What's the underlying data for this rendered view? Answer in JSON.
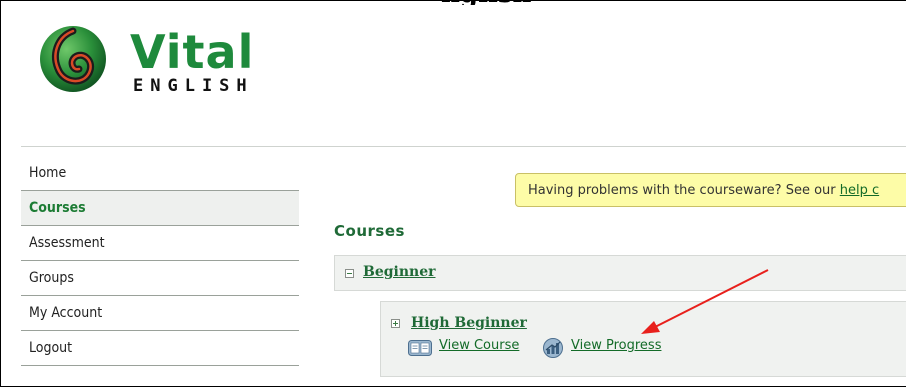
{
  "header": {
    "cut_heading": "nglish",
    "logo": {
      "brand": "Vital",
      "sub": "ENGLISH",
      "brand_color": "#1e8a3c"
    }
  },
  "sidebar": {
    "items": [
      {
        "label": "Home",
        "active": false
      },
      {
        "label": "Courses",
        "active": true
      },
      {
        "label": "Assessment",
        "active": false
      },
      {
        "label": "Groups",
        "active": false
      },
      {
        "label": "My Account",
        "active": false
      },
      {
        "label": "Logout",
        "active": false
      }
    ]
  },
  "help_banner": {
    "text": "Having problems with the courseware? See our ",
    "link": "help c"
  },
  "main": {
    "title": "Courses",
    "courses": [
      {
        "label": "Beginner",
        "expanded": true,
        "icon": "minus-toggle-icon",
        "children": [
          {
            "label": "High Beginner",
            "icon": "plus-toggle-icon",
            "actions": [
              {
                "label": "View Course",
                "icon": "book-icon"
              },
              {
                "label": "View Progress",
                "icon": "chart-icon"
              }
            ]
          }
        ]
      }
    ]
  },
  "annotation": {
    "color": "#e8201c",
    "icon": "red-arrow"
  }
}
